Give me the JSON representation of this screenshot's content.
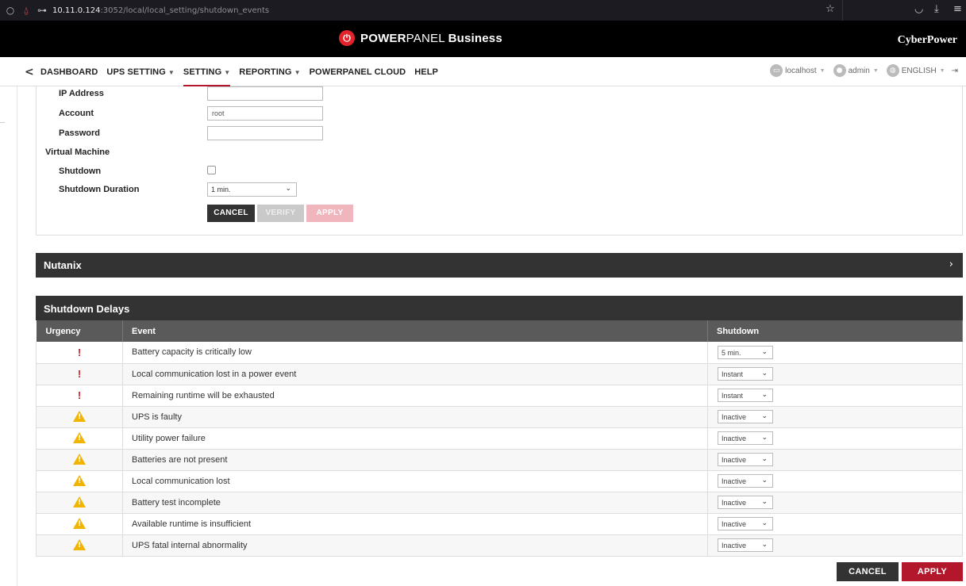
{
  "browser": {
    "url_host": "10.11.0.124",
    "url_rest": ":3052/local/local_setting/shutdown_events"
  },
  "app": {
    "logo_bold": "POWER",
    "logo_light": "PANEL",
    "logo_suffix": "Business",
    "brand": "CyberPower"
  },
  "nav": {
    "items": [
      {
        "label": "DASHBOARD"
      },
      {
        "label": "UPS SETTING"
      },
      {
        "label": "SETTING"
      },
      {
        "label": "REPORTING"
      },
      {
        "label": "POWERPANEL CLOUD"
      },
      {
        "label": "HELP"
      }
    ],
    "host": "localhost",
    "user": "admin",
    "language": "ENGLISH"
  },
  "form": {
    "ip_label": "IP Address",
    "ip_value": "",
    "account_label": "Account",
    "account_value": "root",
    "password_label": "Password",
    "password_value": "",
    "vm_label": "Virtual Machine",
    "shutdown_label": "Shutdown",
    "duration_label": "Shutdown Duration",
    "duration_value": "1 min.",
    "cancel": "CANCEL",
    "verify": "VERIFY",
    "apply": "APPLY"
  },
  "nutanix": {
    "title": "Nutanix"
  },
  "shutdown_delays": {
    "title": "Shutdown Delays",
    "headers": [
      "Urgency",
      "Event",
      "Shutdown"
    ],
    "rows": [
      {
        "urgency": "critical",
        "event": "Battery capacity is critically low",
        "shutdown": "5 min."
      },
      {
        "urgency": "critical",
        "event": "Local communication lost in a power event",
        "shutdown": "Instant"
      },
      {
        "urgency": "critical",
        "event": "Remaining runtime will be exhausted",
        "shutdown": "Instant"
      },
      {
        "urgency": "warning",
        "event": "UPS is faulty",
        "shutdown": "Inactive"
      },
      {
        "urgency": "warning",
        "event": "Utility power failure",
        "shutdown": "Inactive"
      },
      {
        "urgency": "warning",
        "event": "Batteries are not present",
        "shutdown": "Inactive"
      },
      {
        "urgency": "warning",
        "event": "Local communication lost",
        "shutdown": "Inactive"
      },
      {
        "urgency": "warning",
        "event": "Battery test incomplete",
        "shutdown": "Inactive"
      },
      {
        "urgency": "warning",
        "event": "Available runtime is insufficient",
        "shutdown": "Inactive"
      },
      {
        "urgency": "warning",
        "event": "UPS fatal internal abnormality",
        "shutdown": "Inactive"
      }
    ],
    "cancel": "CANCEL",
    "apply": "APPLY"
  },
  "colors": {
    "accent": "#b2172b",
    "header_bg": "#000000",
    "section_bg": "#333333",
    "warning": "#f1b400",
    "critical": "#d0202a"
  },
  "icons": {
    "critical": "exclamation-icon",
    "warning": "warning-triangle-icon"
  }
}
